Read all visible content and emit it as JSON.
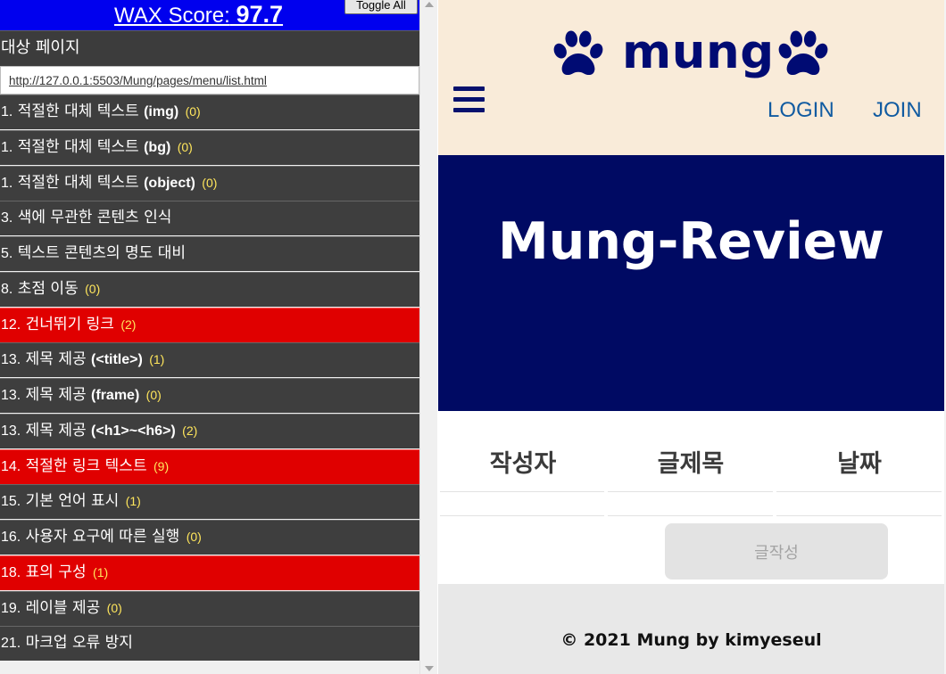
{
  "wax": {
    "score_label": "WAX Score:",
    "score_value": "97.7",
    "toggle_label": "Toggle All",
    "target_label": "대상 페이지",
    "target_url": "http://127.0.0.1:5503/Mung/pages/menu/list.html",
    "rows": [
      {
        "num": "1.",
        "label": "적절한 대체 텍스트",
        "extra": "(img)",
        "count": "(0)",
        "status": "pass"
      },
      {
        "num": "1.",
        "label": "적절한 대체 텍스트",
        "extra": "(bg)",
        "count": "(0)",
        "status": "pass"
      },
      {
        "num": "1.",
        "label": "적절한 대체 텍스트",
        "extra": "(object)",
        "count": "(0)",
        "status": "pass"
      },
      {
        "num": "3.",
        "label": "색에 무관한 콘텐츠 인식",
        "extra": "",
        "count": "",
        "status": "pass"
      },
      {
        "num": "5.",
        "label": "텍스트 콘텐츠의 명도 대비",
        "extra": "",
        "count": "",
        "status": "pass"
      },
      {
        "num": "8.",
        "label": "초점 이동",
        "extra": "",
        "count": "(0)",
        "status": "pass"
      },
      {
        "num": "12.",
        "label": "건너뛰기 링크",
        "extra": "",
        "count": "(2)",
        "status": "error"
      },
      {
        "num": "13.",
        "label": "제목 제공",
        "extra": "(<title>)",
        "count": "(1)",
        "status": "pass"
      },
      {
        "num": "13.",
        "label": "제목 제공",
        "extra": "(frame)",
        "count": "(0)",
        "status": "pass"
      },
      {
        "num": "13.",
        "label": "제목 제공",
        "extra": "(<h1>~<h6>)",
        "count": "(2)",
        "status": "pass"
      },
      {
        "num": "14.",
        "label": "적절한 링크 텍스트",
        "extra": "",
        "count": "(9)",
        "status": "error"
      },
      {
        "num": "15.",
        "label": "기본 언어 표시",
        "extra": "",
        "count": "(1)",
        "status": "pass"
      },
      {
        "num": "16.",
        "label": "사용자 요구에 따른 실행",
        "extra": "",
        "count": "(0)",
        "status": "pass"
      },
      {
        "num": "18.",
        "label": "표의 구성",
        "extra": "",
        "count": "(1)",
        "status": "error"
      },
      {
        "num": "19.",
        "label": "레이블 제공",
        "extra": "",
        "count": "(0)",
        "status": "pass"
      },
      {
        "num": "21.",
        "label": "마크업 오류 방지",
        "extra": "",
        "count": "",
        "status": "pass"
      }
    ]
  },
  "site": {
    "logo_text": "mung",
    "nav": {
      "login": "LOGIN",
      "join": "JOIN"
    },
    "hero_title": "Mung-Review",
    "table_headers": {
      "author": "작성자",
      "title": "글제목",
      "date": "날짜"
    },
    "write_button": "글작성",
    "footer": "© 2021 Mung by kimyeseul"
  },
  "colors": {
    "wax_header": "#0000ee",
    "wax_row": "#3e3e3e",
    "wax_row_error": "#e00000",
    "wax_count": "#ffe65c",
    "site_header_bg": "#f9ebd9",
    "brand_navy": "#000b73",
    "nav_link": "#115ba1",
    "hero_bg": "#000a63",
    "footer_bg": "#e8e8e8"
  },
  "icons": {
    "paw": "paw-icon",
    "menu": "hamburger-menu-icon"
  }
}
